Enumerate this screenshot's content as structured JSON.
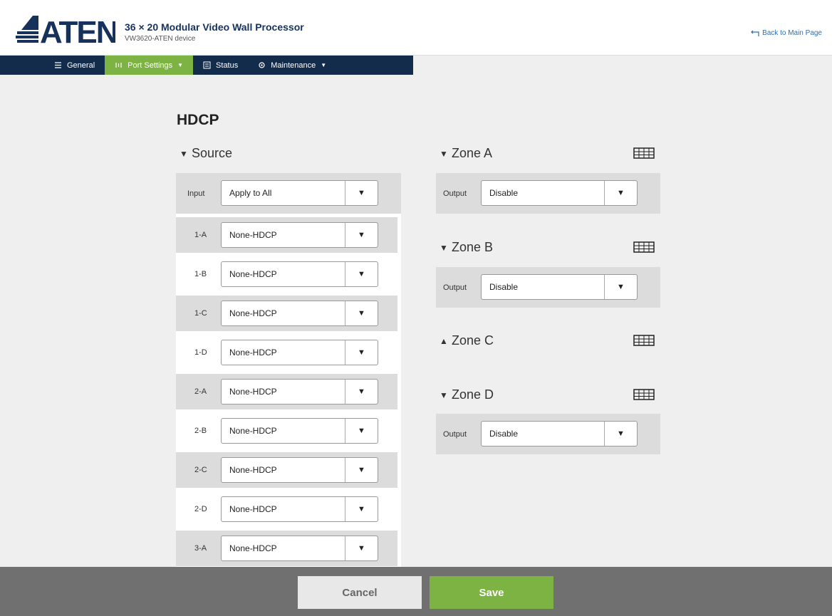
{
  "header": {
    "logo_text": "ATEN",
    "title": "36 × 20 Modular Video Wall Processor",
    "subtitle": "VW3620-ATEN device",
    "back_link": "Back to Main Page"
  },
  "nav": {
    "items": [
      {
        "label": "General",
        "icon": "list-icon"
      },
      {
        "label": "Port Settings",
        "icon": "port-icon",
        "active": true
      },
      {
        "label": "Status",
        "icon": "status-icon"
      },
      {
        "label": "Maintenance",
        "icon": "gear-icon"
      }
    ]
  },
  "page": {
    "title": "HDCP"
  },
  "source": {
    "heading": "Source",
    "input_label": "Input",
    "input_value": "Apply to All",
    "ports": [
      {
        "label": "1-A",
        "value": "None-HDCP"
      },
      {
        "label": "1-B",
        "value": "None-HDCP"
      },
      {
        "label": "1-C",
        "value": "None-HDCP"
      },
      {
        "label": "1-D",
        "value": "None-HDCP"
      },
      {
        "label": "2-A",
        "value": "None-HDCP"
      },
      {
        "label": "2-B",
        "value": "None-HDCP"
      },
      {
        "label": "2-C",
        "value": "None-HDCP"
      },
      {
        "label": "2-D",
        "value": "None-HDCP"
      },
      {
        "label": "3-A",
        "value": "None-HDCP"
      }
    ]
  },
  "zones": [
    {
      "heading": "Zone A",
      "expanded": true,
      "output_label": "Output",
      "output_value": "Disable"
    },
    {
      "heading": "Zone B",
      "expanded": true,
      "output_label": "Output",
      "output_value": "Disable"
    },
    {
      "heading": "Zone C",
      "expanded": false
    },
    {
      "heading": "Zone D",
      "expanded": true,
      "output_label": "Output",
      "output_value": "Disable"
    }
  ],
  "footer": {
    "cancel_label": "Cancel",
    "save_label": "Save"
  },
  "colors": {
    "nav_bg": "#142c4c",
    "accent_green": "#7cb342",
    "footer_bg": "#707070",
    "title_blue": "#17325a"
  }
}
